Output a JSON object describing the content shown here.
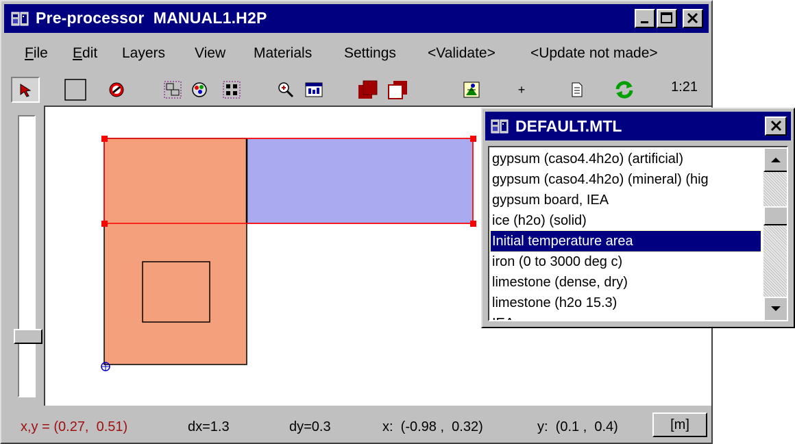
{
  "window": {
    "title": "Pre-processor  MANUAL1.H2P",
    "minimize_label": "_",
    "close_label": "×"
  },
  "menu": {
    "file": "File",
    "edit": "Edit",
    "layers": "Layers",
    "view": "View",
    "materials": "Materials",
    "settings": "Settings",
    "validate": "<Validate>",
    "update": "<Update not made>"
  },
  "toolbar": {
    "time": "1:21",
    "plus": "+",
    "icons": [
      "select-arrow-icon",
      "rectangle-tool-icon",
      "no-entry-icon",
      "layers-icon",
      "palette-icon",
      "grid-icon",
      "zoom-icon",
      "window-icon",
      "fill-front-icon",
      "fill-back-icon",
      "run-icon",
      "plus-icon",
      "page-icon",
      "refresh-icon"
    ]
  },
  "status": {
    "xy": "x,y = (0.27,  0.51)",
    "dx": "dx=1.3",
    "dy": "dy=0.3",
    "x_range": "x:  (-0.98 ,  0.32)",
    "y_range": "y:  (0.1 ,  0.4)",
    "unit_button": "[m]"
  },
  "materials_dialog": {
    "title": "DEFAULT.MTL",
    "close_label": "×",
    "items": [
      "gypsum (caso4.4h2o) (artificial)",
      "gypsum (caso4.4h2o) (mineral) (hig",
      "gypsum board, IEA",
      "ice (h2o) (solid)",
      "Initial temperature area",
      "iron (0 to 3000 deg c)",
      "limestone (dense, dry)",
      "limestone (h2o 15.3)",
      "            IEA"
    ],
    "selected_index": 4
  },
  "colors": {
    "title_bar": "#000080",
    "face": "#c0c0c0",
    "orange_region": "#f4a07c",
    "blue_region": "#aaaaf0",
    "selection_red": "#ff0000",
    "status_red": "#a01010"
  }
}
